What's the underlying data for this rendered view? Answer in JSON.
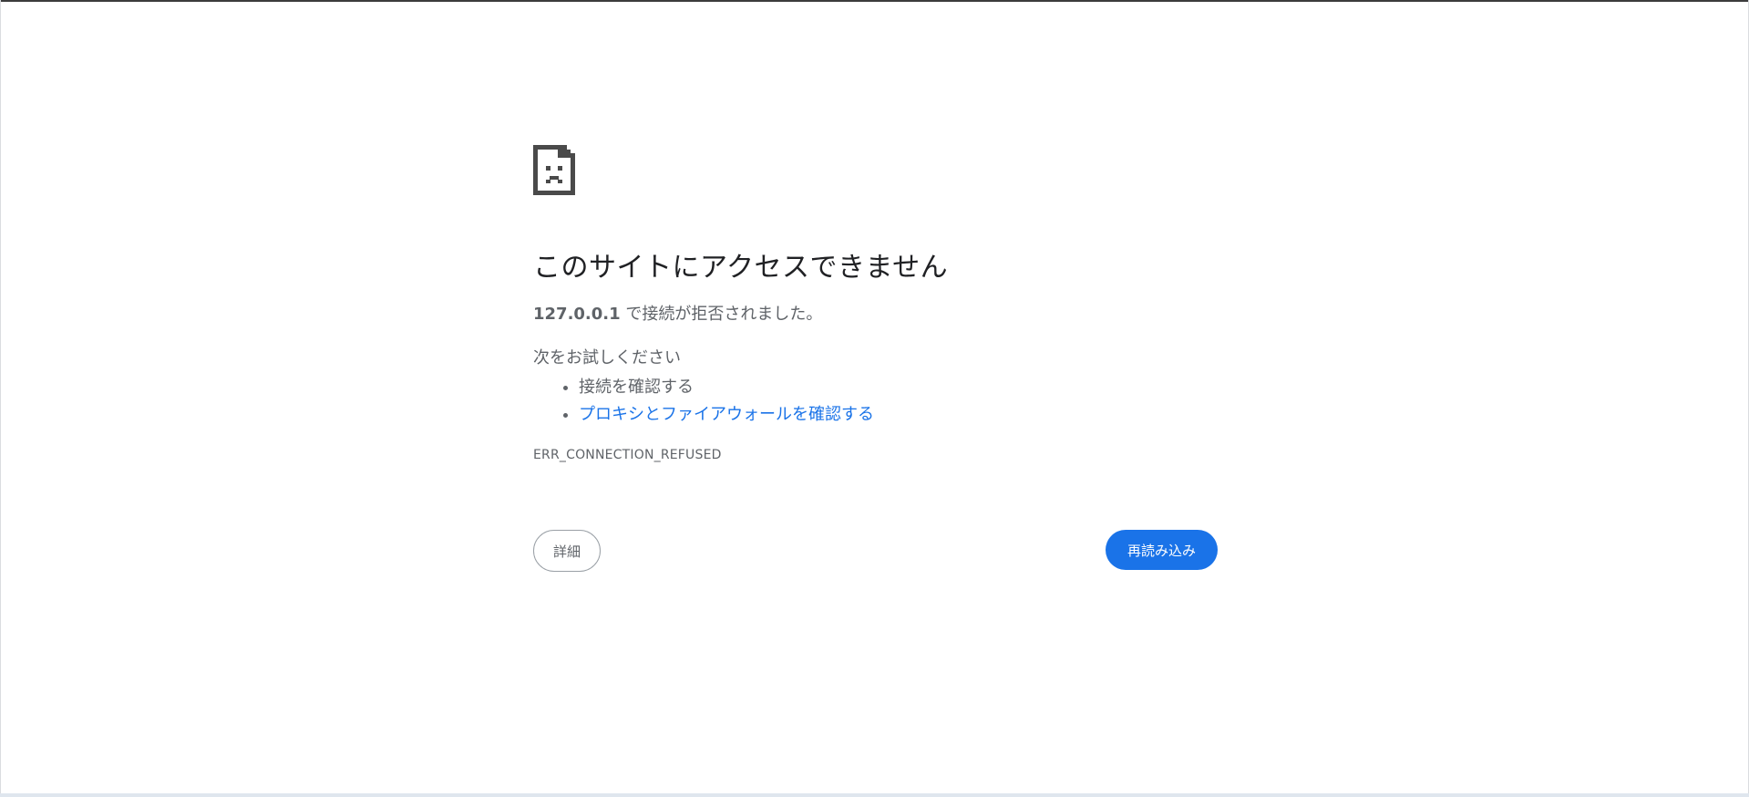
{
  "error_page": {
    "icon": "sad-page-icon",
    "heading": "このサイトにアクセスできません",
    "summary_host": "127.0.0.1",
    "summary_text": " で接続が拒否されました。",
    "suggestions_heading": "次をお試しください",
    "suggestions": [
      {
        "label": "接続を確認する",
        "link": false
      },
      {
        "label": "プロキシとファイアウォールを確認する",
        "link": true
      }
    ],
    "error_code": "ERR_CONNECTION_REFUSED"
  },
  "buttons": {
    "details_label": "詳細",
    "reload_label": "再読み込み"
  },
  "colors": {
    "accent": "#1a73e8",
    "text_secondary": "#5f6368",
    "text_primary": "#202124"
  }
}
